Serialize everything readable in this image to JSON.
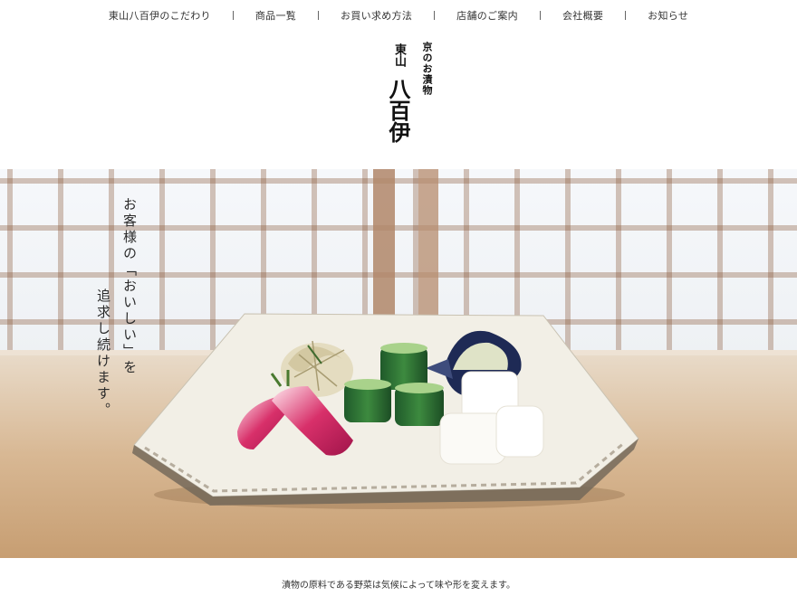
{
  "nav": {
    "items": [
      "東山八百伊のこだわり",
      "商品一覧",
      "お買い求め方法",
      "店舗のご案内",
      "会社概要",
      "お知らせ"
    ]
  },
  "logo": {
    "line1": "京のお漬物",
    "line2": "東山",
    "line3": "八百伊"
  },
  "hero": {
    "tagline_1": "お客様の「おいしい」を",
    "tagline_2": "追求し続けます。"
  },
  "intro": {
    "text": "漬物の原料である野菜は気候によって味や形を変えます。"
  },
  "colors": {
    "nav_text": "#333333",
    "table_wood": "#c9a77c",
    "shoji_frame": "#8a5a3a"
  }
}
